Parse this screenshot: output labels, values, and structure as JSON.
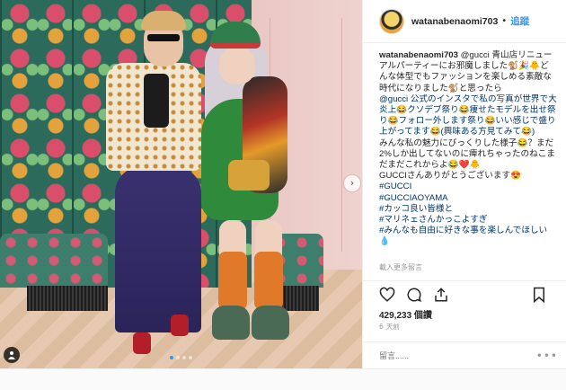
{
  "post": {
    "username": "watanabenaomi703",
    "separator": "•",
    "follow_label": "追蹤",
    "caption_user": "watanabenaomi703",
    "caption_lines": [
      "@gucci 青山店リニューアルパーティーにお邪魔しました🐒🎉🐥どんな体型でもファッションを楽しめる素敵な時代になりました🐒と思ったら",
      "@gucci 公式のインスタで私の写真が世界で大炎上😂クソデブ祭り😂痩せたモデルを出せ祭り😂フォロー外します祭り😂いい感じで盛り上がってます😂(興味ある方見てみて😂)",
      "みんな私の魅力にびっくりした様子😂？まだ2%しか出してないのに痺れちゃったのねこまだまだこれからよ😂❤️🐥",
      "GUCCIさんありがとうございます😍"
    ],
    "hashtags": [
      "#GUCCI",
      "#GUCCIAOYAMA",
      "#カッコ良い皆様と",
      "#マリネェさんかっこよすぎ",
      "#みんなも自由に好きな事を楽しんでほしい💧"
    ],
    "load_comments": "載入更多留言",
    "likes": "429,233 個讚",
    "time": "6 天前",
    "comment_placeholder": "留言......",
    "more": "•••"
  },
  "photo": {
    "carousel_arrow": "›",
    "dots_count": 4,
    "active_dot": 0,
    "tag_icon": "person-tag-icon"
  },
  "icons": [
    "heart-icon",
    "comment-icon",
    "share-icon",
    "bookmark-icon",
    "chevron-right-icon",
    "person-tag-icon"
  ],
  "colors": {
    "accent": "#3897f0",
    "text": "#262626",
    "muted": "#999999",
    "border": "#efefef"
  }
}
